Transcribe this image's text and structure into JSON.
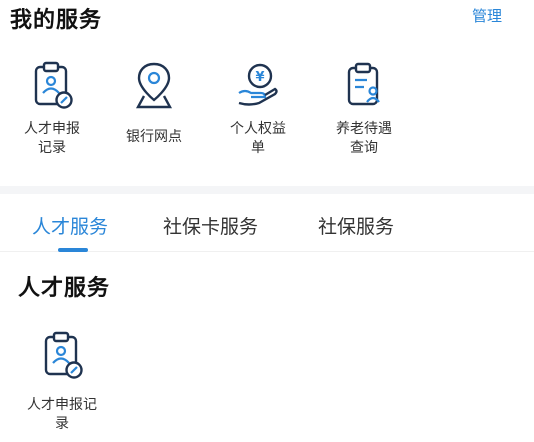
{
  "header": {
    "title": "我的服务",
    "manage_label": "管理"
  },
  "my_services": [
    {
      "label": "人才申报\n记录",
      "icon": "clipboard-person-icon"
    },
    {
      "label": "银行网点",
      "icon": "location-pin-icon"
    },
    {
      "label": "个人权益\n单",
      "icon": "hand-yuan-coin-icon"
    },
    {
      "label": "养老待遇\n查询",
      "icon": "clipboard-list-person-icon"
    }
  ],
  "tabs": [
    {
      "label": "人才服务",
      "active": true
    },
    {
      "label": "社保卡服务",
      "active": false
    },
    {
      "label": "社保服务",
      "active": false
    }
  ],
  "section": {
    "title": "人才服务",
    "items": [
      {
        "label": "人才申报记\n录",
        "icon": "clipboard-person-icon"
      }
    ]
  },
  "colors": {
    "accent": "#2a86d8",
    "icon_stroke": "#1f3350"
  }
}
